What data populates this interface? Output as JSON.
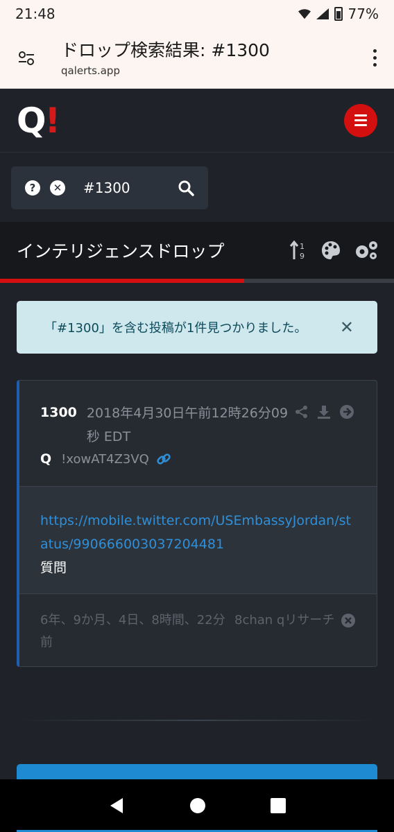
{
  "status": {
    "time": "21:48",
    "battery": "77%"
  },
  "browser": {
    "title": "ドロップ検索結果: #1300",
    "url": "qalerts.app"
  },
  "header": {
    "logo_q": "Q",
    "logo_bang": "!"
  },
  "search": {
    "query": "#1300"
  },
  "section": {
    "title": "インテリジェンスドロップ",
    "progress": 0.62
  },
  "alert": {
    "message": "「#1300」を含む投稿が1件見つかりました。"
  },
  "post": {
    "number": "1300",
    "date": "2018年4月30日午前12時26分09秒 EDT",
    "author": "Q",
    "trip": "!xowAT4Z3VQ",
    "link": "https://mobile.twitter.com/USEmbassyJordan/status/990666003037204481",
    "text": "質問",
    "ago": "6年、9か月、4日、8時間、22分前",
    "source": "8chan qリサーチ"
  },
  "colors": {
    "accent": "#d40f0f",
    "link": "#2f8fd8",
    "card_border": "#1d5fae"
  },
  "icons": [
    "tune-icon",
    "menu-kebab-icon",
    "hamburger-icon",
    "help-icon",
    "clear-icon",
    "search-icon",
    "sort-icon",
    "palette-icon",
    "cogs-icon",
    "close-icon",
    "share-icon",
    "download-icon",
    "arrow-right-icon",
    "link-icon",
    "remove-icon",
    "back-icon",
    "home-icon",
    "recents-icon"
  ]
}
